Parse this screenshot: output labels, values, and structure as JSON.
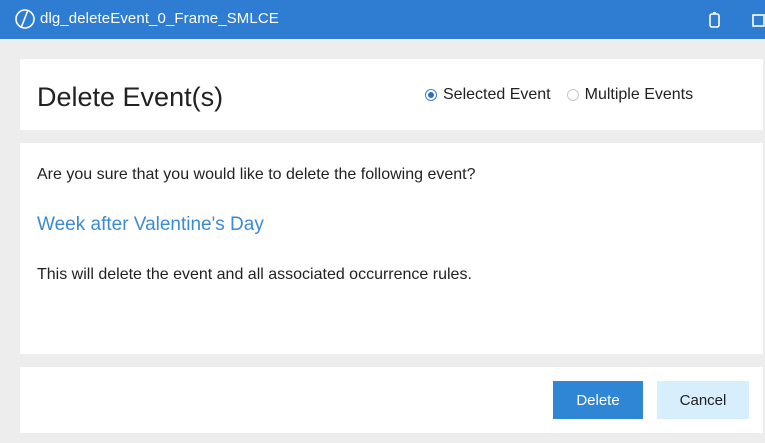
{
  "window": {
    "title": "dlg_deleteEvent_0_Frame_SMLCE",
    "icons": [
      "app-logo-icon",
      "restore-icon",
      "maximize-icon"
    ]
  },
  "header": {
    "title": "Delete Event(s)",
    "options": [
      {
        "label": "Selected Event",
        "checked": true
      },
      {
        "label": "Multiple Events",
        "checked": false
      }
    ]
  },
  "body": {
    "question": "Are you sure that you would like to delete the following event?",
    "event_name": "Week after Valentine's Day",
    "warning": "This will delete the event and all associated occurrence rules."
  },
  "footer": {
    "delete_label": "Delete",
    "cancel_label": "Cancel"
  },
  "colors": {
    "titlebar": "#2f7dd2",
    "accent": "#2f86d5",
    "link": "#3c8ad2",
    "cancel_bg": "#d7eefc",
    "frame_bg": "#ededed"
  }
}
